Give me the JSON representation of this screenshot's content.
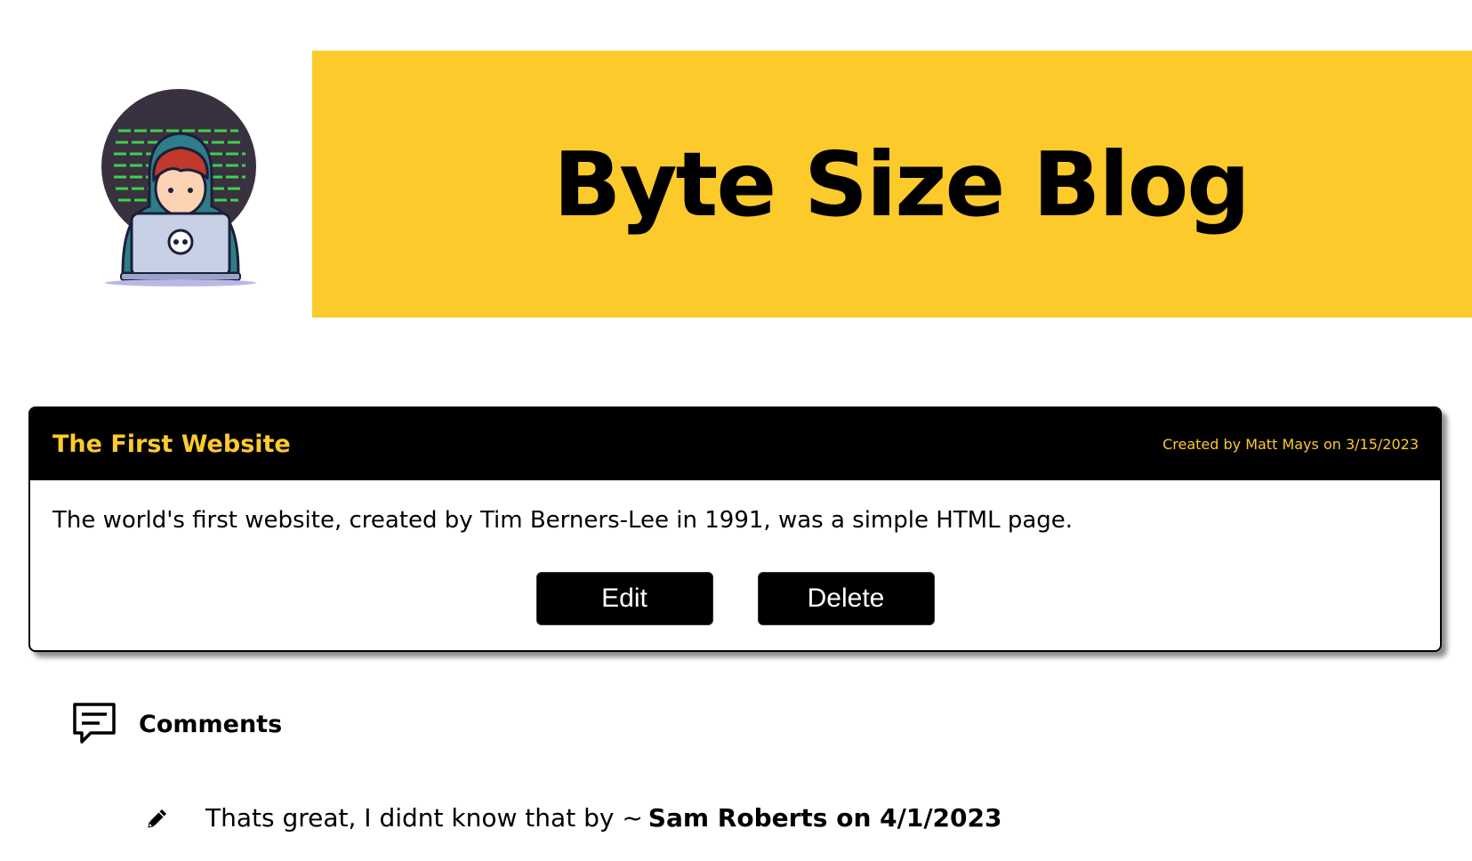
{
  "header": {
    "title": "Byte Size Blog",
    "banner_color": "#fdca2c",
    "logo_icon": "hacker-laptop-avatar"
  },
  "post": {
    "title": "The First Website",
    "meta": "Created by Matt Mays on 3/15/2023",
    "body": "The world's first website, created by Tim Berners-Lee in 1991, was a simple HTML page.",
    "edit_label": "Edit",
    "delete_label": "Delete"
  },
  "comments": {
    "heading": "Comments",
    "heading_icon": "comment-icon",
    "items": [
      {
        "icon": "pencil-icon",
        "text": "Thats great, I didnt know that by ~",
        "author": "Sam Roberts on 4/1/2023"
      }
    ]
  }
}
